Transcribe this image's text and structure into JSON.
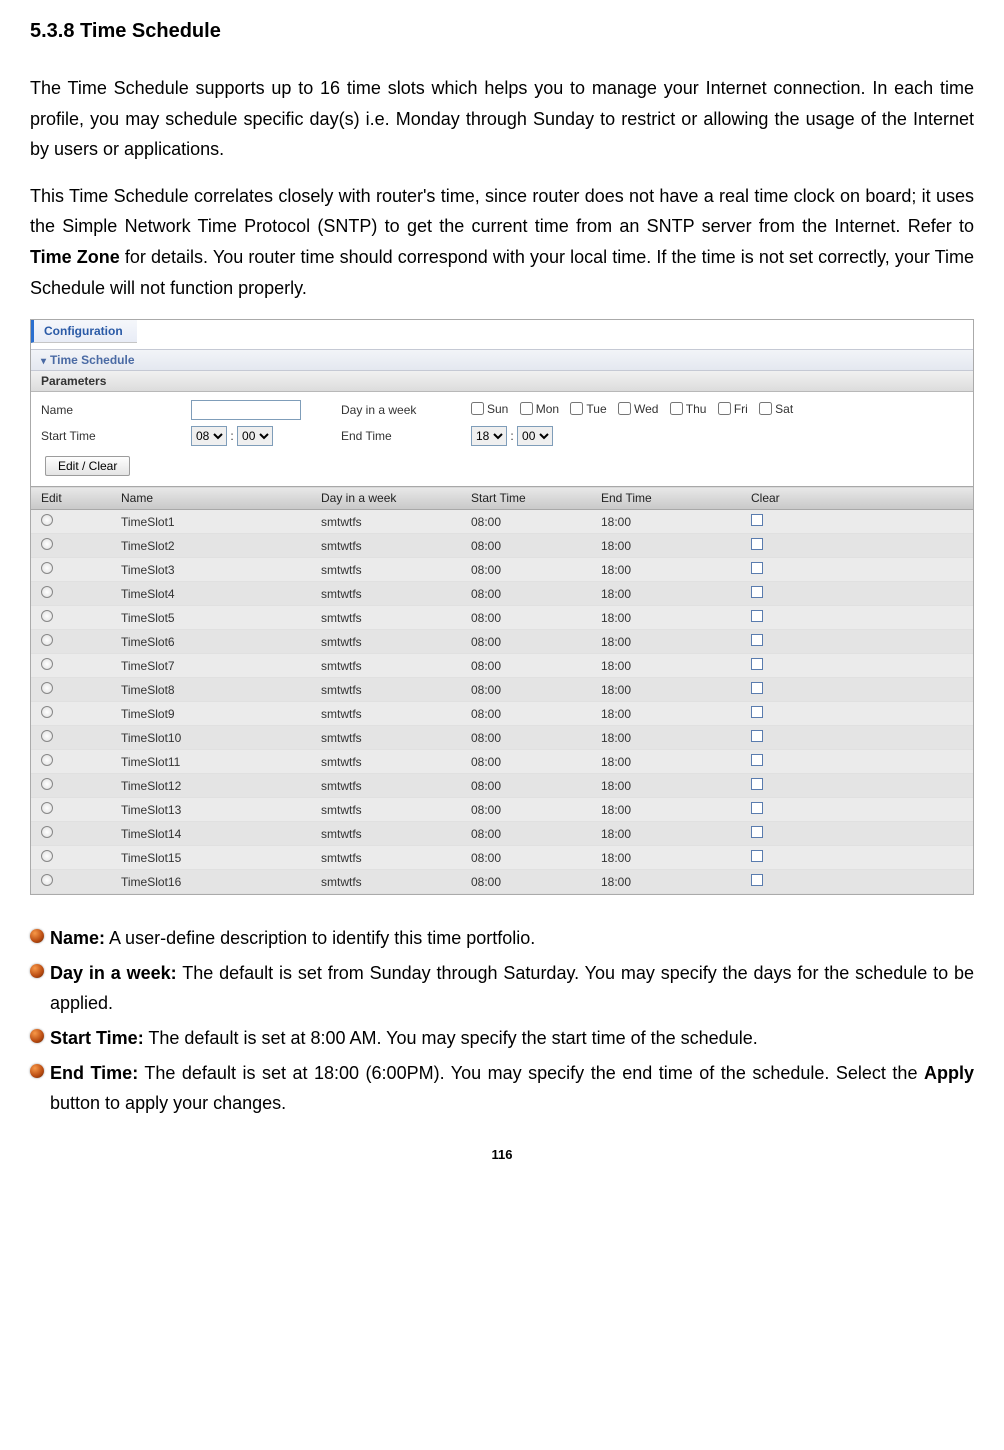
{
  "heading": "5.3.8 Time Schedule",
  "para1": "The Time Schedule supports up to 16 time slots which helps you to manage your Internet connection. In each time profile, you may schedule specific day(s) i.e. Monday through Sunday to restrict or allowing the usage of the Internet by users or applications.",
  "para2a": "This Time Schedule correlates closely with router's time, since router does not have a real time clock on board; it uses the Simple Network Time Protocol (SNTP) to get the current time from an SNTP server from the Internet. Refer to ",
  "para2b": "Time Zone",
  "para2c": " for details. You router time should correspond with your local time. If the time is not set correctly, your Time Schedule will not function properly.",
  "ui": {
    "configTab": "Configuration",
    "sectionBar": "Time Schedule",
    "paramsBar": "Parameters",
    "labels": {
      "name": "Name",
      "dayInWeek": "Day in a week",
      "startTime": "Start Time",
      "endTime": "End Time"
    },
    "days": [
      "Sun",
      "Mon",
      "Tue",
      "Wed",
      "Thu",
      "Fri",
      "Sat"
    ],
    "startHour": "08",
    "startMin": "00",
    "endHour": "18",
    "endMin": "00",
    "btnEditClear": "Edit / Clear",
    "columns": {
      "edit": "Edit",
      "name": "Name",
      "day": "Day in a week",
      "start": "Start Time",
      "end": "End Time",
      "clear": "Clear"
    },
    "rows": [
      {
        "name": "TimeSlot1",
        "day": "smtwtfs",
        "start": "08:00",
        "end": "18:00"
      },
      {
        "name": "TimeSlot2",
        "day": "smtwtfs",
        "start": "08:00",
        "end": "18:00"
      },
      {
        "name": "TimeSlot3",
        "day": "smtwtfs",
        "start": "08:00",
        "end": "18:00"
      },
      {
        "name": "TimeSlot4",
        "day": "smtwtfs",
        "start": "08:00",
        "end": "18:00"
      },
      {
        "name": "TimeSlot5",
        "day": "smtwtfs",
        "start": "08:00",
        "end": "18:00"
      },
      {
        "name": "TimeSlot6",
        "day": "smtwtfs",
        "start": "08:00",
        "end": "18:00"
      },
      {
        "name": "TimeSlot7",
        "day": "smtwtfs",
        "start": "08:00",
        "end": "18:00"
      },
      {
        "name": "TimeSlot8",
        "day": "smtwtfs",
        "start": "08:00",
        "end": "18:00"
      },
      {
        "name": "TimeSlot9",
        "day": "smtwtfs",
        "start": "08:00",
        "end": "18:00"
      },
      {
        "name": "TimeSlot10",
        "day": "smtwtfs",
        "start": "08:00",
        "end": "18:00"
      },
      {
        "name": "TimeSlot11",
        "day": "smtwtfs",
        "start": "08:00",
        "end": "18:00"
      },
      {
        "name": "TimeSlot12",
        "day": "smtwtfs",
        "start": "08:00",
        "end": "18:00"
      },
      {
        "name": "TimeSlot13",
        "day": "smtwtfs",
        "start": "08:00",
        "end": "18:00"
      },
      {
        "name": "TimeSlot14",
        "day": "smtwtfs",
        "start": "08:00",
        "end": "18:00"
      },
      {
        "name": "TimeSlot15",
        "day": "smtwtfs",
        "start": "08:00",
        "end": "18:00"
      },
      {
        "name": "TimeSlot16",
        "day": "smtwtfs",
        "start": "08:00",
        "end": "18:00"
      }
    ]
  },
  "defs": {
    "name_l": "Name:",
    "name_t": " A user-define description to identify this time portfolio.",
    "day_l": "Day in a week:",
    "day_t": " The default is set from Sunday through Saturday. You may specify the days for the schedule to be applied.",
    "start_l": "Start Time:",
    "start_t": " The default is set at 8:00 AM. You may specify the start time of the schedule.",
    "end_l": "End Time:",
    "end_t_a": " The default is set at 18:00 (6:00PM). You may specify the end time of the schedule. Select the ",
    "end_t_b": "Apply",
    "end_t_c": " button to apply your changes."
  },
  "pageNum": "116"
}
